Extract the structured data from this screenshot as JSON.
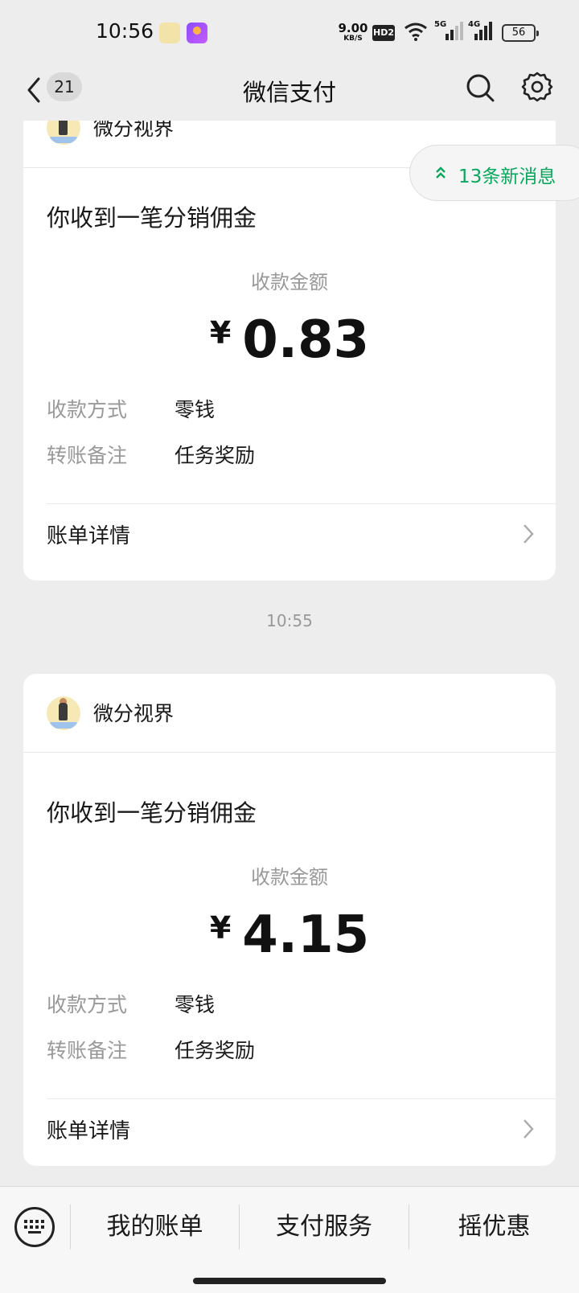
{
  "status_bar": {
    "time": "10:56",
    "net_speed_value": "9.00",
    "net_speed_unit": "KB/S",
    "hd_badge": "HD2",
    "signal_1": "5G",
    "signal_2": "4G",
    "battery": "56"
  },
  "nav": {
    "unread_count": "21",
    "title": "微信支付"
  },
  "new_messages": "13条新消息",
  "messages": [
    {
      "merchant": "微分视界",
      "title": "你收到一笔分销佣金",
      "amount_label": "收款金额",
      "currency": "¥",
      "amount": "0.83",
      "rows": [
        {
          "label": "收款方式",
          "value": "零钱"
        },
        {
          "label": "转账备注",
          "value": "任务奖励"
        }
      ],
      "detail_label": "账单详情"
    },
    {
      "timestamp": "10:55",
      "merchant": "微分视界",
      "title": "你收到一笔分销佣金",
      "amount_label": "收款金额",
      "currency": "¥",
      "amount": "4.15",
      "rows": [
        {
          "label": "收款方式",
          "value": "零钱"
        },
        {
          "label": "转账备注",
          "value": "任务奖励"
        }
      ],
      "detail_label": "账单详情"
    }
  ],
  "bottom_menu": [
    "我的账单",
    "支付服务",
    "摇优惠"
  ],
  "colors": {
    "accent_green": "#07a85b",
    "background": "#ededed",
    "card": "#ffffff"
  }
}
